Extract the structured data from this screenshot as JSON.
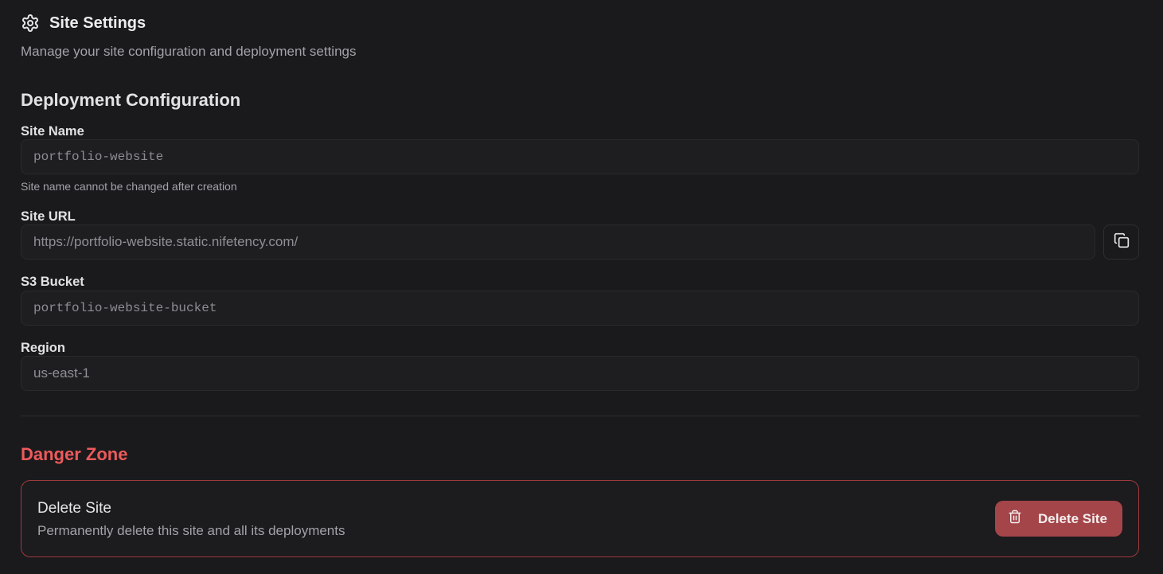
{
  "header": {
    "icon": "gear-icon",
    "title": "Site Settings",
    "subtitle": "Manage your site configuration and deployment settings"
  },
  "deployment": {
    "section_title": "Deployment Configuration",
    "site_name": {
      "label": "Site Name",
      "value": "portfolio-website",
      "help": "Site name cannot be changed after creation"
    },
    "site_url": {
      "label": "Site URL",
      "value": "https://portfolio-website.static.nifetency.com/",
      "copy_icon": "copy-icon"
    },
    "s3_bucket": {
      "label": "S3 Bucket",
      "value": "portfolio-website-bucket"
    },
    "region": {
      "label": "Region",
      "value": "us-east-1"
    }
  },
  "danger_zone": {
    "section_title": "Danger Zone",
    "card_title": "Delete Site",
    "card_description": "Permanently delete this site and all its deployments",
    "delete_button_label": "Delete Site",
    "delete_icon": "trash-icon"
  },
  "colors": {
    "background": "#1a1a1d",
    "danger_text": "#ee5a5a",
    "danger_border": "#9e3b3f",
    "danger_button": "#a4454a"
  }
}
